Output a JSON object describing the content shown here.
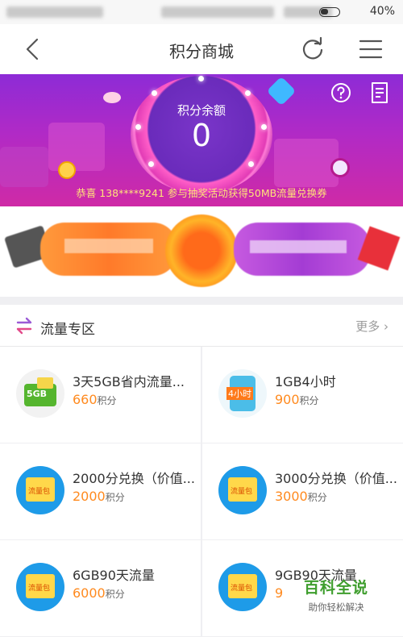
{
  "status_bar": {
    "battery": "40%"
  },
  "nav": {
    "title": "积分商城"
  },
  "banner": {
    "points_label": "积分余额",
    "points_value": "0",
    "notice": "恭喜 138****9241 参与抽奖活动获得50MB流量兑换券"
  },
  "section": {
    "title": "流量专区",
    "more": "更多"
  },
  "products": [
    {
      "name": "3天5GB省内流量...",
      "price": "660",
      "unit": "积分",
      "badge": "5GB"
    },
    {
      "name": "1GB4小时",
      "price": "900",
      "unit": "积分",
      "badge": "4小时"
    },
    {
      "name": "2000分兑换（价值...",
      "price": "2000",
      "unit": "积分",
      "badge": "流量包"
    },
    {
      "name": "3000分兑换（价值...",
      "price": "3000",
      "unit": "积分",
      "badge": "流量包"
    },
    {
      "name": "6GB90天流量",
      "price": "6000",
      "unit": "积分",
      "badge": "流量包"
    },
    {
      "name": "9GB90天流量",
      "price": "9",
      "unit": "",
      "badge": "流量包"
    }
  ],
  "watermark": {
    "main": "百科全说",
    "sub": "助你轻松解决"
  },
  "colors": {
    "accent": "#ff8a1f",
    "banner": "#b12ac6",
    "icon_blue": "#1e9be8"
  }
}
